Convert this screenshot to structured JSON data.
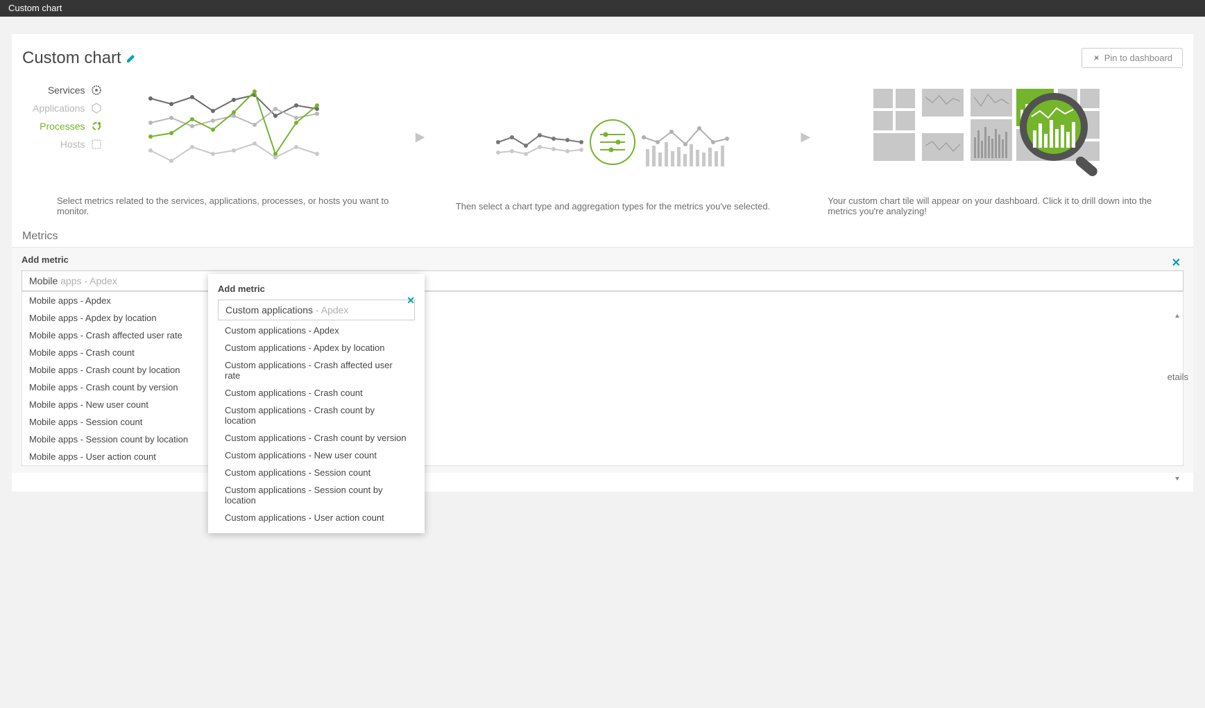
{
  "topbar": {
    "title": "Custom chart"
  },
  "header": {
    "title": "Custom chart",
    "pin_label": "Pin to dashboard"
  },
  "sources": {
    "services": "Services",
    "applications": "Applications",
    "processes": "Processes",
    "hosts": "Hosts"
  },
  "steps": {
    "step1": "Select metrics related to the services, applications, processes, or hosts you want to monitor.",
    "step2": "Then select a chart type and aggregation types for the metrics you've selected.",
    "step3": "Your custom chart tile will appear on your dashboard. Click it to drill down into the metrics you're analyzing!"
  },
  "metrics_label": "Metrics",
  "details_text": "etails",
  "panel1": {
    "title": "Add metric",
    "typed": "Mobile",
    "hint": " apps - Apdex",
    "options": [
      "Mobile apps - Apdex",
      "Mobile apps - Apdex by location",
      "Mobile apps - Crash affected user rate",
      "Mobile apps - Crash count",
      "Mobile apps - Crash count by location",
      "Mobile apps - Crash count by version",
      "Mobile apps - New user count",
      "Mobile apps - Session count",
      "Mobile apps - Session count by location",
      "Mobile apps - User action count"
    ]
  },
  "panel2": {
    "title": "Add metric",
    "typed": "Custom applications",
    "hint": " - Apdex",
    "options": [
      "Custom applications - Apdex",
      "Custom applications - Apdex by location",
      "Custom applications - Crash affected user rate",
      "Custom applications - Crash count",
      "Custom applications - Crash count by location",
      "Custom applications - Crash count by version",
      "Custom applications - New user count",
      "Custom applications - Session count",
      "Custom applications - Session count by location",
      "Custom applications - User action count"
    ]
  }
}
